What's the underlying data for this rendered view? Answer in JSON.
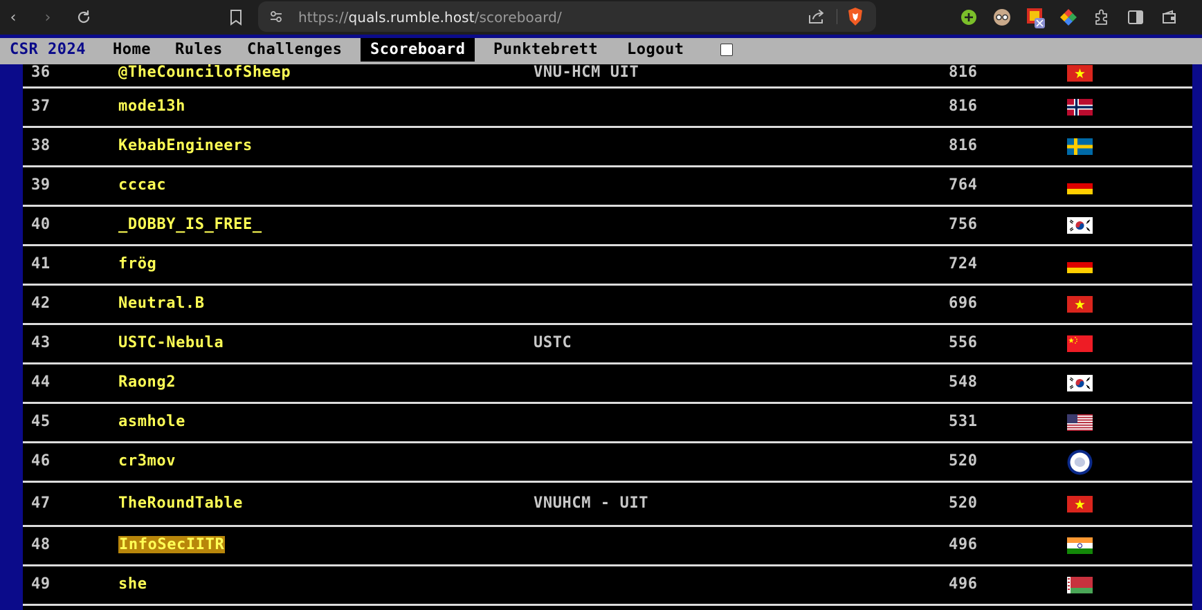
{
  "browser": {
    "url_scheme": "https://",
    "url_host": "quals.rumble.host",
    "url_path": "/scoreboard/"
  },
  "nav": {
    "brand": "CSR 2024",
    "items": [
      "Home",
      "Rules",
      "Challenges",
      "Scoreboard",
      "Punktebrett",
      "Logout"
    ],
    "active": "Scoreboard"
  },
  "scoreboard": {
    "rows": [
      {
        "rank": "36",
        "team": "@TheCouncilofSheep",
        "affiliation": "VNU-HCM UIT",
        "score": "816",
        "flag": "vn"
      },
      {
        "rank": "37",
        "team": "mode13h",
        "affiliation": "",
        "score": "816",
        "flag": "no"
      },
      {
        "rank": "38",
        "team": "KebabEngineers",
        "affiliation": "",
        "score": "816",
        "flag": "se"
      },
      {
        "rank": "39",
        "team": "cccac",
        "affiliation": "",
        "score": "764",
        "flag": "de"
      },
      {
        "rank": "40",
        "team": "_DOBBY_IS_FREE_",
        "affiliation": "",
        "score": "756",
        "flag": "kr"
      },
      {
        "rank": "41",
        "team": "frög",
        "affiliation": "",
        "score": "724",
        "flag": "de"
      },
      {
        "rank": "42",
        "team": "Neutral.B",
        "affiliation": "",
        "score": "696",
        "flag": "vn"
      },
      {
        "rank": "43",
        "team": "USTC-Nebula",
        "affiliation": "USTC",
        "score": "556",
        "flag": "cn"
      },
      {
        "rank": "44",
        "team": "Raong2",
        "affiliation": "",
        "score": "548",
        "flag": "kr"
      },
      {
        "rank": "45",
        "team": "asmhole",
        "affiliation": "",
        "score": "531",
        "flag": "us"
      },
      {
        "rank": "46",
        "team": "cr3mov",
        "affiliation": "",
        "score": "520",
        "flag": "aq"
      },
      {
        "rank": "47",
        "team": "TheRoundTable",
        "affiliation": "VNUHCM - UIT",
        "score": "520",
        "flag": "vn"
      },
      {
        "rank": "48",
        "team": "InfoSecIITR",
        "affiliation": "",
        "score": "496",
        "flag": "in",
        "highlighted": true
      },
      {
        "rank": "49",
        "team": "she",
        "affiliation": "",
        "score": "496",
        "flag": "by"
      }
    ]
  },
  "colors": {
    "page_background": "#0b0b8a",
    "table_background": "#000000",
    "team_text": "#ffff55",
    "highlight": "#b8860b",
    "nav_background": "#b4b4b4"
  }
}
